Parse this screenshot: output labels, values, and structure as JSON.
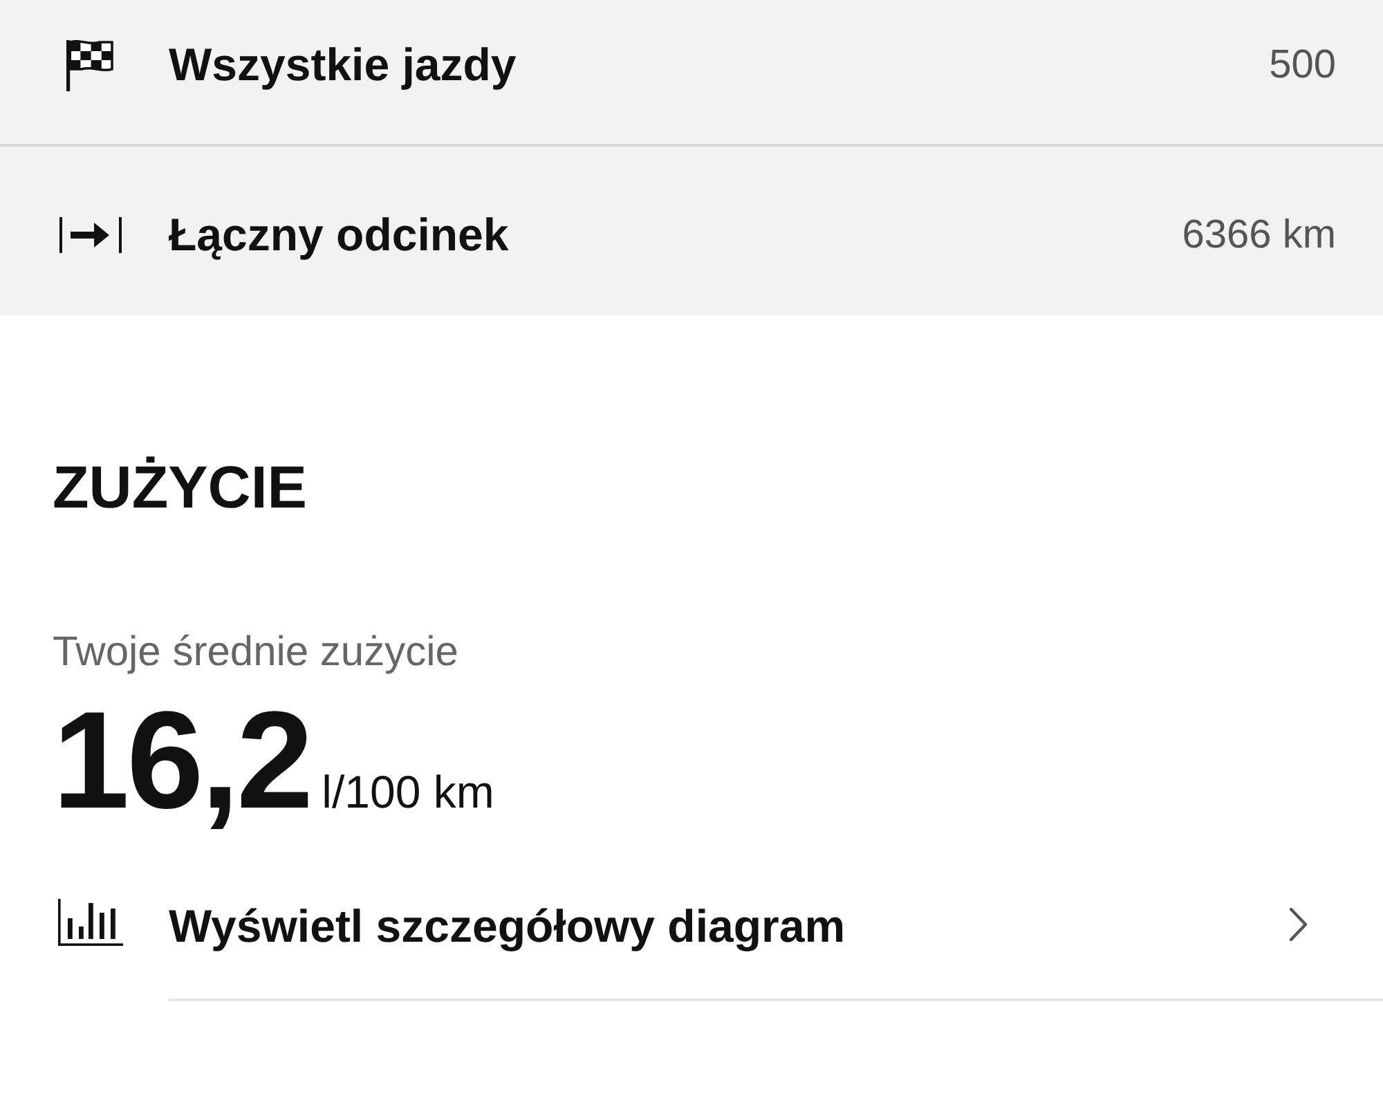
{
  "summary_rows": [
    {
      "kind": "flag",
      "label": "Wszystkie jazdy",
      "value": "500"
    },
    {
      "kind": "distance",
      "label": "Łączny odcinek",
      "value": "6366 km"
    }
  ],
  "consumption": {
    "heading": "ZUŻYCIE",
    "caption": "Twoje średnie zużycie",
    "value": "16,2",
    "unit": "l/100 km"
  },
  "links": [
    {
      "kind": "chart",
      "label": "Wyświetl szczegółowy diagram"
    }
  ]
}
